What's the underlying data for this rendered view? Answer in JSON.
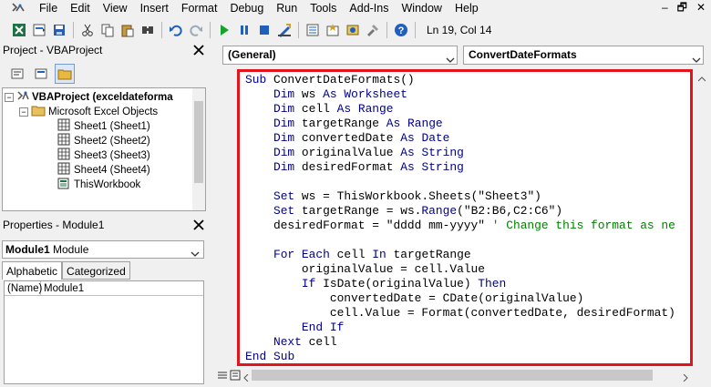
{
  "menu": {
    "items": [
      "File",
      "Edit",
      "View",
      "Insert",
      "Format",
      "Debug",
      "Run",
      "Tools",
      "Add-Ins",
      "Window",
      "Help"
    ]
  },
  "window_controls": {
    "minimize": "–",
    "restore": "🗗",
    "close": "✕"
  },
  "toolbar": {
    "cursor_position": "Ln 19, Col 14"
  },
  "project_pane": {
    "title": "Project - VBAProject",
    "tree": [
      {
        "label": "VBAProject (exceldateforma",
        "level": 0,
        "bold": true
      },
      {
        "label": "Microsoft Excel Objects",
        "level": 1
      },
      {
        "label": "Sheet1 (Sheet1)",
        "level": 2
      },
      {
        "label": "Sheet2 (Sheet2)",
        "level": 2
      },
      {
        "label": "Sheet3 (Sheet3)",
        "level": 2
      },
      {
        "label": "Sheet4 (Sheet4)",
        "level": 2
      },
      {
        "label": "ThisWorkbook",
        "level": 2
      }
    ]
  },
  "properties_pane": {
    "title": "Properties - Module1",
    "object_name": "Module1",
    "object_type": "Module",
    "tabs": [
      "Alphabetic",
      "Categorized"
    ],
    "active_tab": "Alphabetic",
    "rows": [
      {
        "key": "(Name)",
        "value": "Module1"
      }
    ]
  },
  "code_window": {
    "object_combo": "(General)",
    "procedure_combo": "ConvertDateFormats",
    "lines": [
      "Sub ConvertDateFormats()",
      "    Dim ws As Worksheet",
      "    Dim cell As Range",
      "    Dim targetRange As Range",
      "    Dim convertedDate As Date",
      "    Dim originalValue As String",
      "    Dim desiredFormat As String",
      "",
      "    Set ws = ThisWorkbook.Sheets(\"Sheet3\")",
      "    Set targetRange = ws.Range(\"B2:B6,C2:C6\")",
      "    desiredFormat = \"dddd mm-yyyy\" ' Change this format as ne",
      "",
      "    For Each cell In targetRange",
      "        originalValue = cell.Value",
      "        If IsDate(originalValue) Then",
      "            convertedDate = CDate(originalValue)",
      "            cell.Value = Format(convertedDate, desiredFormat)",
      "        End If",
      "    Next cell",
      "End Sub"
    ]
  },
  "colors": {
    "highlight_border": "#e3141b",
    "keyword": "#00008b",
    "comment": "#008000"
  }
}
